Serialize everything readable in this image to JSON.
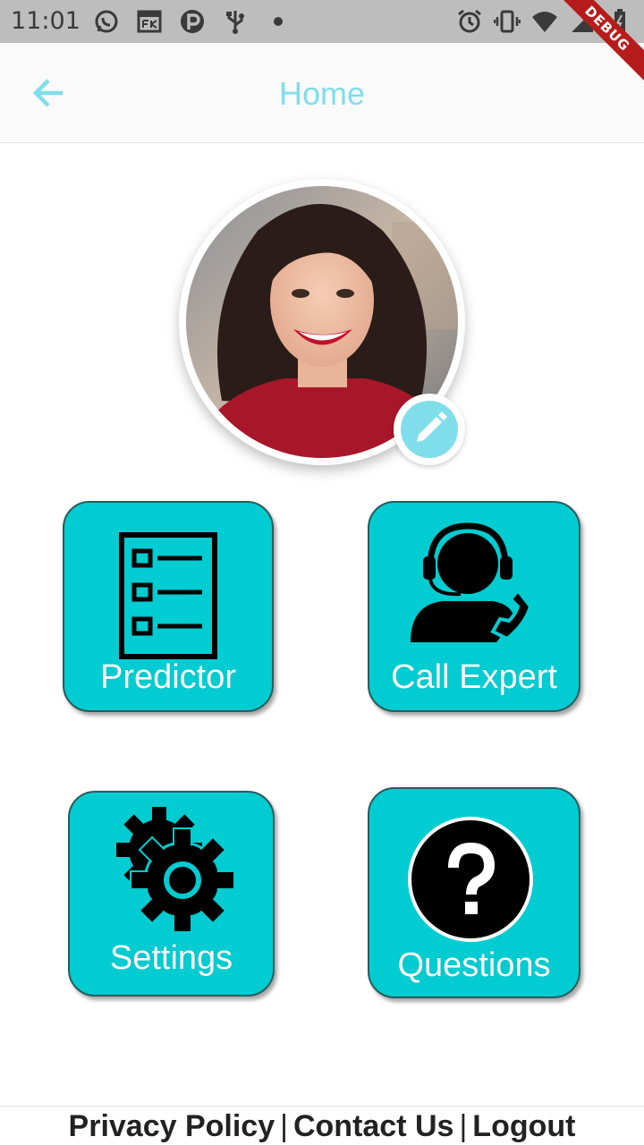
{
  "status_bar": {
    "time": "11:01",
    "left_icons": [
      "whatsapp-icon",
      "fk-app-icon",
      "p-app-icon",
      "usb-icon",
      "dot-icon"
    ],
    "right_icons": [
      "alarm-icon",
      "vibrate-icon",
      "wifi-icon",
      "signal-icon",
      "battery-icon"
    ]
  },
  "debug_banner": "DEBUG",
  "app_bar": {
    "title": "Home",
    "back_icon": "arrow-back-icon",
    "accent_color": "#80deea"
  },
  "profile": {
    "avatar_alt": "profile-photo",
    "edit_icon": "pencil-icon"
  },
  "tiles": {
    "color": "#00ccd1",
    "predictor": {
      "label": "Predictor",
      "icon": "checklist-icon"
    },
    "call_expert": {
      "label": "Call Expert",
      "icon": "support-agent-icon"
    },
    "settings": {
      "label": "Settings",
      "icon": "gears-icon"
    },
    "questions": {
      "label": "Questions",
      "icon": "question-circle-icon"
    }
  },
  "footer": {
    "privacy": "Privacy Policy",
    "contact": "Contact Us",
    "logout": "Logout",
    "separator": "|"
  }
}
